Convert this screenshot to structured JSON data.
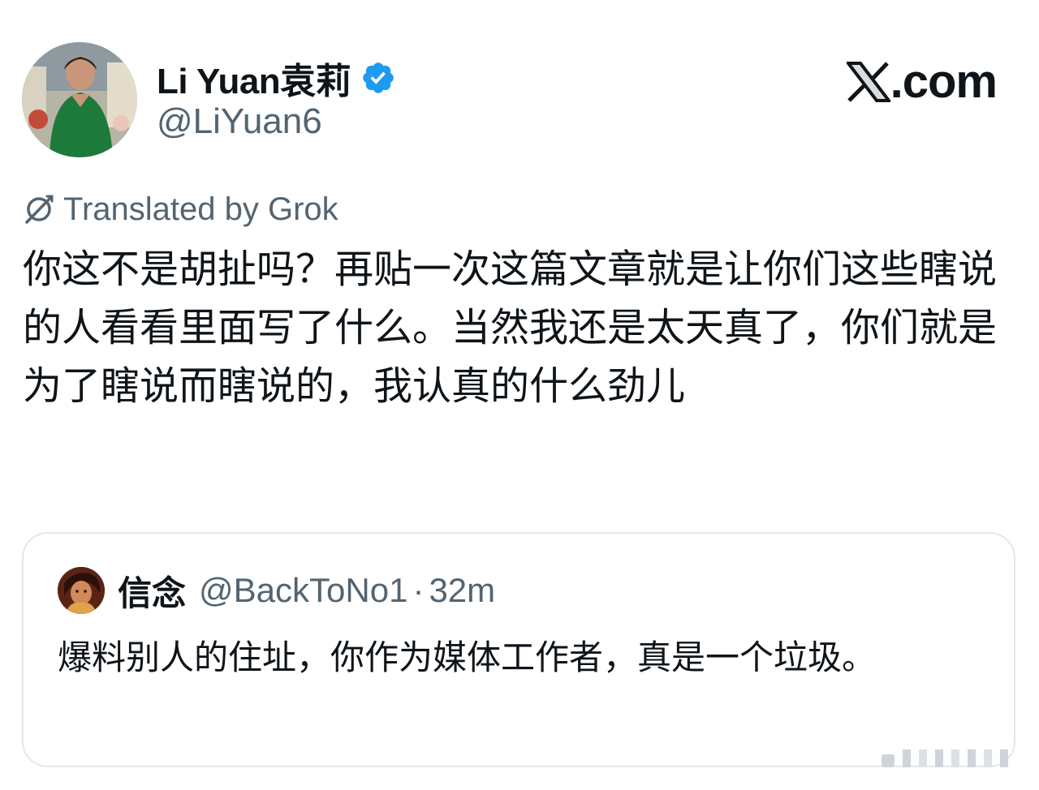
{
  "author": {
    "name": "Li Yuan袁莉",
    "handle": "@LiYuan6",
    "verified": true,
    "verified_color": "#1d9bf0"
  },
  "brand": {
    "domain": "𝕏.com",
    "domain_text": ".com"
  },
  "translation": {
    "icon": "grok-icon",
    "label": "Translated by Grok"
  },
  "tweet": {
    "text": "你这不是胡扯吗？再贴一次这篇文章就是让你们这些瞎说的人看看里面写了什么。当然我还是太天真了，你们就是为了瞎说而瞎说的，我认真的什么劲儿"
  },
  "quoted_tweet": {
    "name": "信念",
    "handle": "@BackToNo1",
    "separator": "·",
    "time": "32m",
    "text": "爆料别人的住址，你作为媒体工作者，真是一个垃圾。"
  },
  "colors": {
    "text_primary": "#0f1419",
    "text_secondary": "#536471",
    "border": "#e1e8ed",
    "accent": "#1d9bf0"
  }
}
